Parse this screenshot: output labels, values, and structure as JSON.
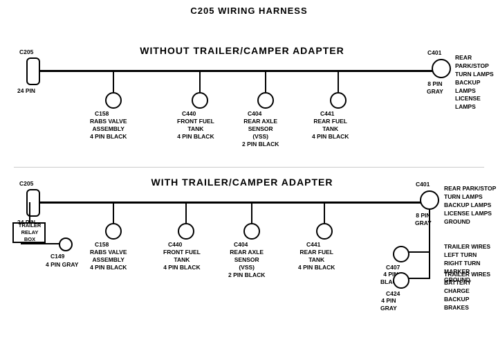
{
  "title": "C205 WIRING HARNESS",
  "section1": {
    "label": "WITHOUT  TRAILER/CAMPER  ADAPTER",
    "left_connector": {
      "id": "C205",
      "pin": "24 PIN"
    },
    "right_connector": {
      "id": "C401",
      "pin": "8 PIN",
      "color": "GRAY",
      "label": "REAR PARK/STOP\nTURN LAMPS\nBACKUP LAMPS\nLICENSE LAMPS"
    },
    "connectors": [
      {
        "id": "C158",
        "label": "RABS VALVE\nASSEMBLY\n4 PIN BLACK"
      },
      {
        "id": "C440",
        "label": "FRONT FUEL\nTANK\n4 PIN BLACK"
      },
      {
        "id": "C404",
        "label": "REAR AXLE\nSENSOR\n(VSS)\n2 PIN BLACK"
      },
      {
        "id": "C441",
        "label": "REAR FUEL\nTANK\n4 PIN BLACK"
      }
    ]
  },
  "section2": {
    "label": "WITH  TRAILER/CAMPER  ADAPTER",
    "left_connector": {
      "id": "C205",
      "pin": "24 PIN"
    },
    "right_connector": {
      "id": "C401",
      "pin": "8 PIN",
      "color": "GRAY",
      "label": "REAR PARK/STOP\nTURN LAMPS\nBACKUP LAMPS\nLICENSE LAMPS\nGROUND"
    },
    "connectors": [
      {
        "id": "C158",
        "label": "RABS VALVE\nASSEMBLY\n4 PIN BLACK"
      },
      {
        "id": "C440",
        "label": "FRONT FUEL\nTANK\n4 PIN BLACK"
      },
      {
        "id": "C404",
        "label": "REAR AXLE\nSENSOR\n(VSS)\n2 PIN BLACK"
      },
      {
        "id": "C441",
        "label": "REAR FUEL\nTANK\n4 PIN BLACK"
      }
    ],
    "extra_left": {
      "box_label": "TRAILER\nRELAY\nBOX",
      "connector_id": "C149",
      "connector_label": "4 PIN GRAY"
    },
    "right_connectors": [
      {
        "id": "C407",
        "pin": "4 PIN",
        "color": "BLACK",
        "label": "TRAILER WIRES\nLEFT TURN\nRIGHT TURN\nMARKER\nGROUND"
      },
      {
        "id": "C424",
        "pin": "4 PIN",
        "color": "GRAY",
        "label": "TRAILER WIRES\nBATTERY CHARGE\nBACKUP\nBRAKES"
      }
    ]
  }
}
